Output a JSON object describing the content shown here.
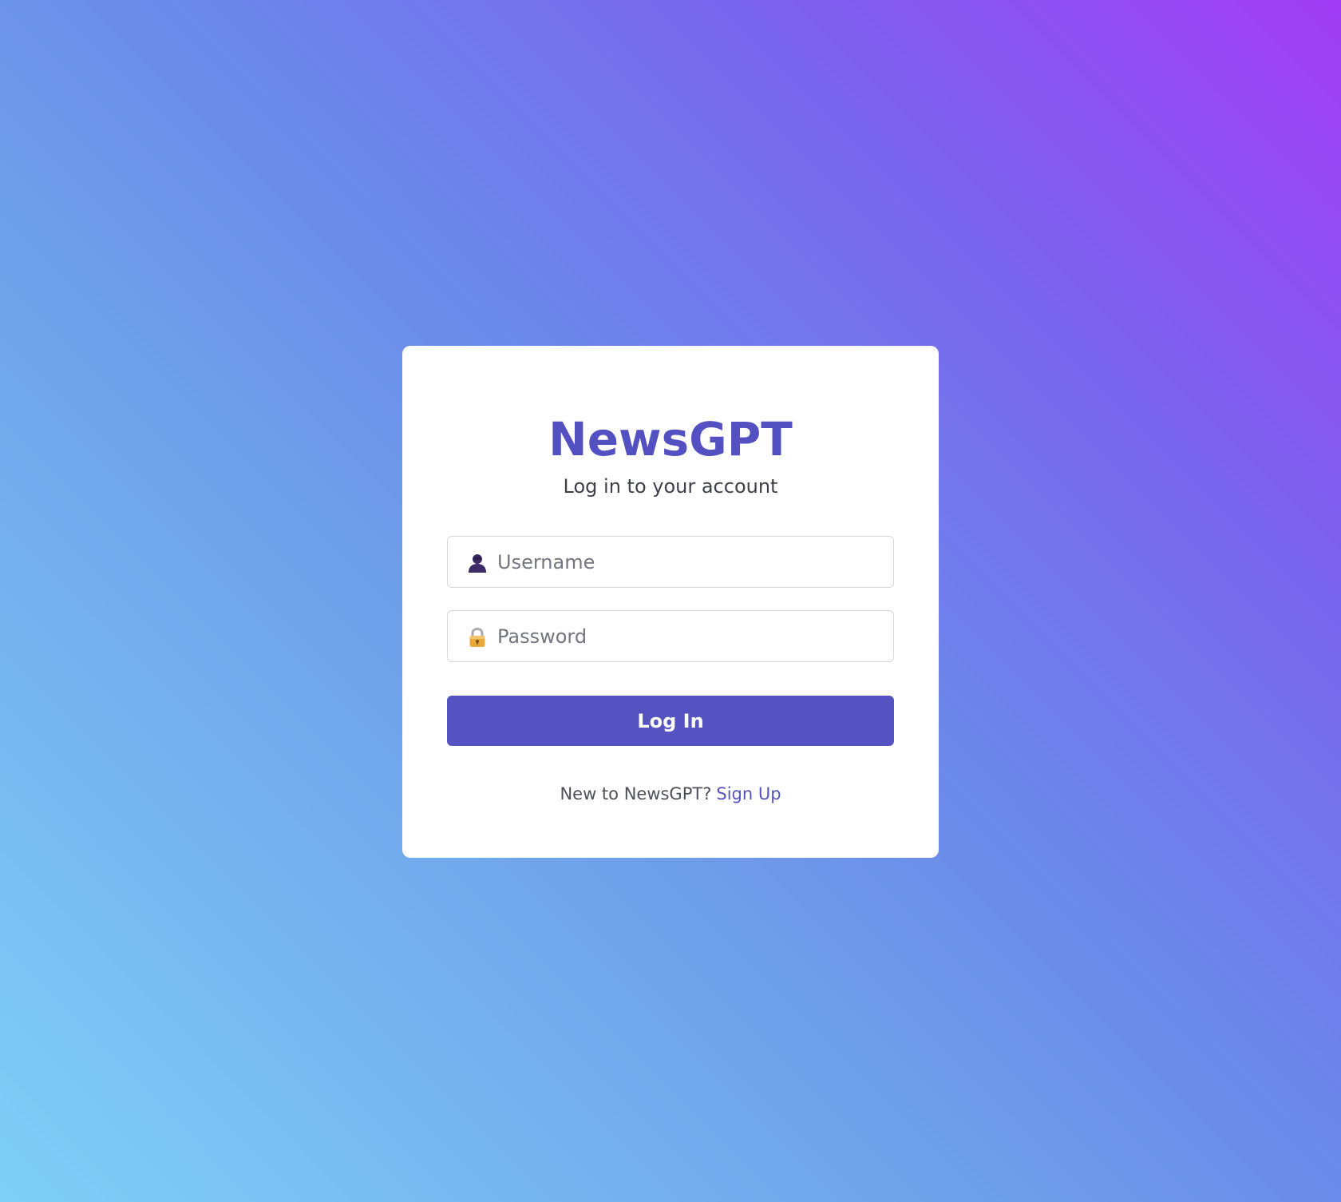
{
  "login": {
    "title": "NewsGPT",
    "subtitle": "Log in to your account",
    "username": {
      "placeholder": "Username",
      "value": "",
      "icon": "user-icon"
    },
    "password": {
      "placeholder": "Password",
      "value": "",
      "icon": "lock-icon"
    },
    "submit_label": "Log In",
    "signup_prompt": "New to NewsGPT?",
    "signup_link": "Sign Up"
  },
  "colors": {
    "brand": "#5453c1",
    "background_start": "#7fd0f7",
    "background_end": "#a23cf5"
  }
}
